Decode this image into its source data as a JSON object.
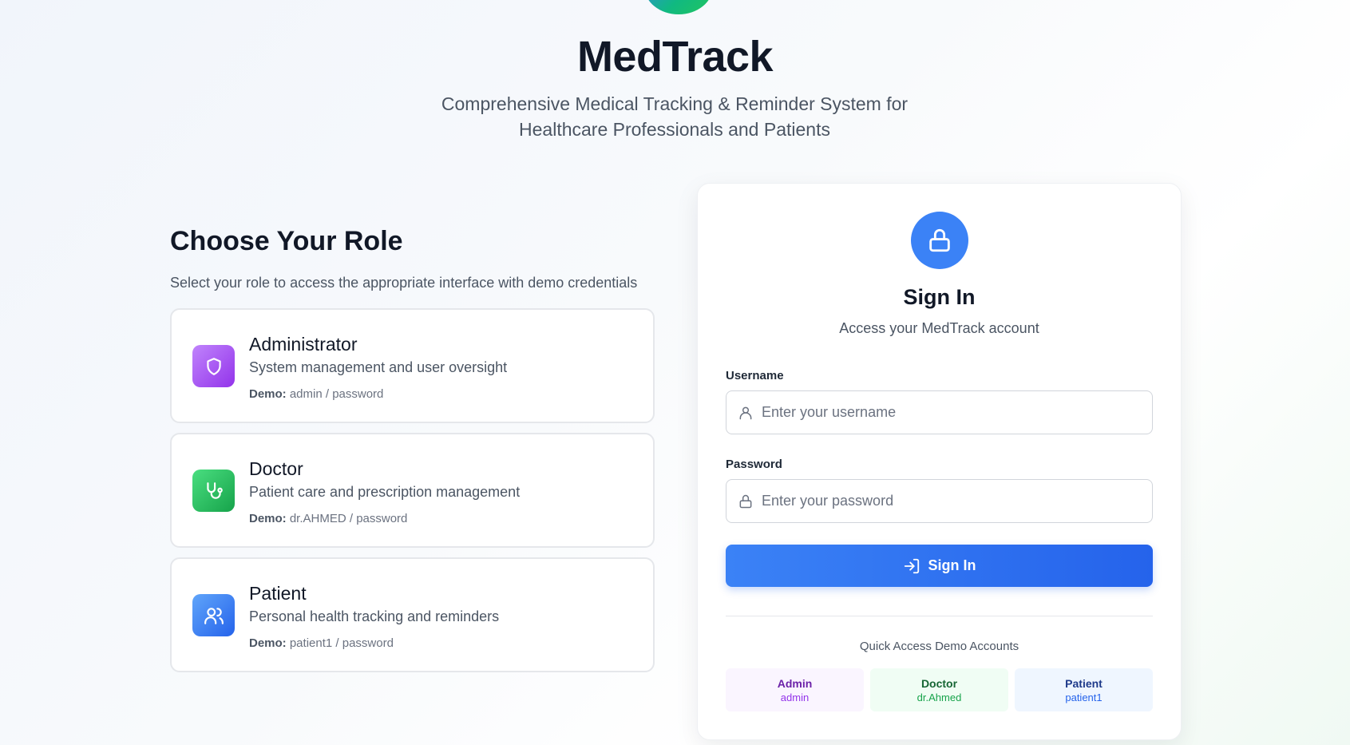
{
  "app": {
    "title": "MedTrack",
    "subtitle": "Comprehensive Medical Tracking & Reminder System for Healthcare Professionals and Patients"
  },
  "roles": {
    "heading": "Choose Your Role",
    "description": "Select your role to access the appropriate interface with demo credentials",
    "items": [
      {
        "title": "Administrator",
        "subtitle": "System management and user oversight",
        "demo_label": "Demo:",
        "demo_value": "admin / password",
        "icon": "shield-icon",
        "color": "#a855f7"
      },
      {
        "title": "Doctor",
        "subtitle": "Patient care and prescription management",
        "demo_label": "Demo:",
        "demo_value": "dr.AHMED / password",
        "icon": "stethoscope-icon",
        "color": "#22c55e"
      },
      {
        "title": "Patient",
        "subtitle": "Personal health tracking and reminders",
        "demo_label": "Demo:",
        "demo_value": "patient1 / password",
        "icon": "users-icon",
        "color": "#3b82f6"
      }
    ]
  },
  "signin": {
    "title": "Sign In",
    "subtitle": "Access your MedTrack account",
    "username_label": "Username",
    "username_placeholder": "Enter your username",
    "password_label": "Password",
    "password_placeholder": "Enter your password",
    "button_label": "Sign In",
    "quick_access_title": "Quick Access Demo Accounts",
    "quick_accounts": [
      {
        "name": "Admin",
        "user": "admin",
        "bg": "#faf5ff",
        "name_color": "#6b21a8",
        "user_color": "#9333ea"
      },
      {
        "name": "Doctor",
        "user": "dr.Ahmed",
        "bg": "#f0fdf4",
        "name_color": "#166534",
        "user_color": "#16a34a"
      },
      {
        "name": "Patient",
        "user": "patient1",
        "bg": "#eff6ff",
        "name_color": "#1e3a8a",
        "user_color": "#2563eb"
      }
    ]
  },
  "colors": {
    "accent": "#3b82f6",
    "admin": "#a855f7",
    "doctor": "#22c55e",
    "patient": "#3b82f6"
  }
}
